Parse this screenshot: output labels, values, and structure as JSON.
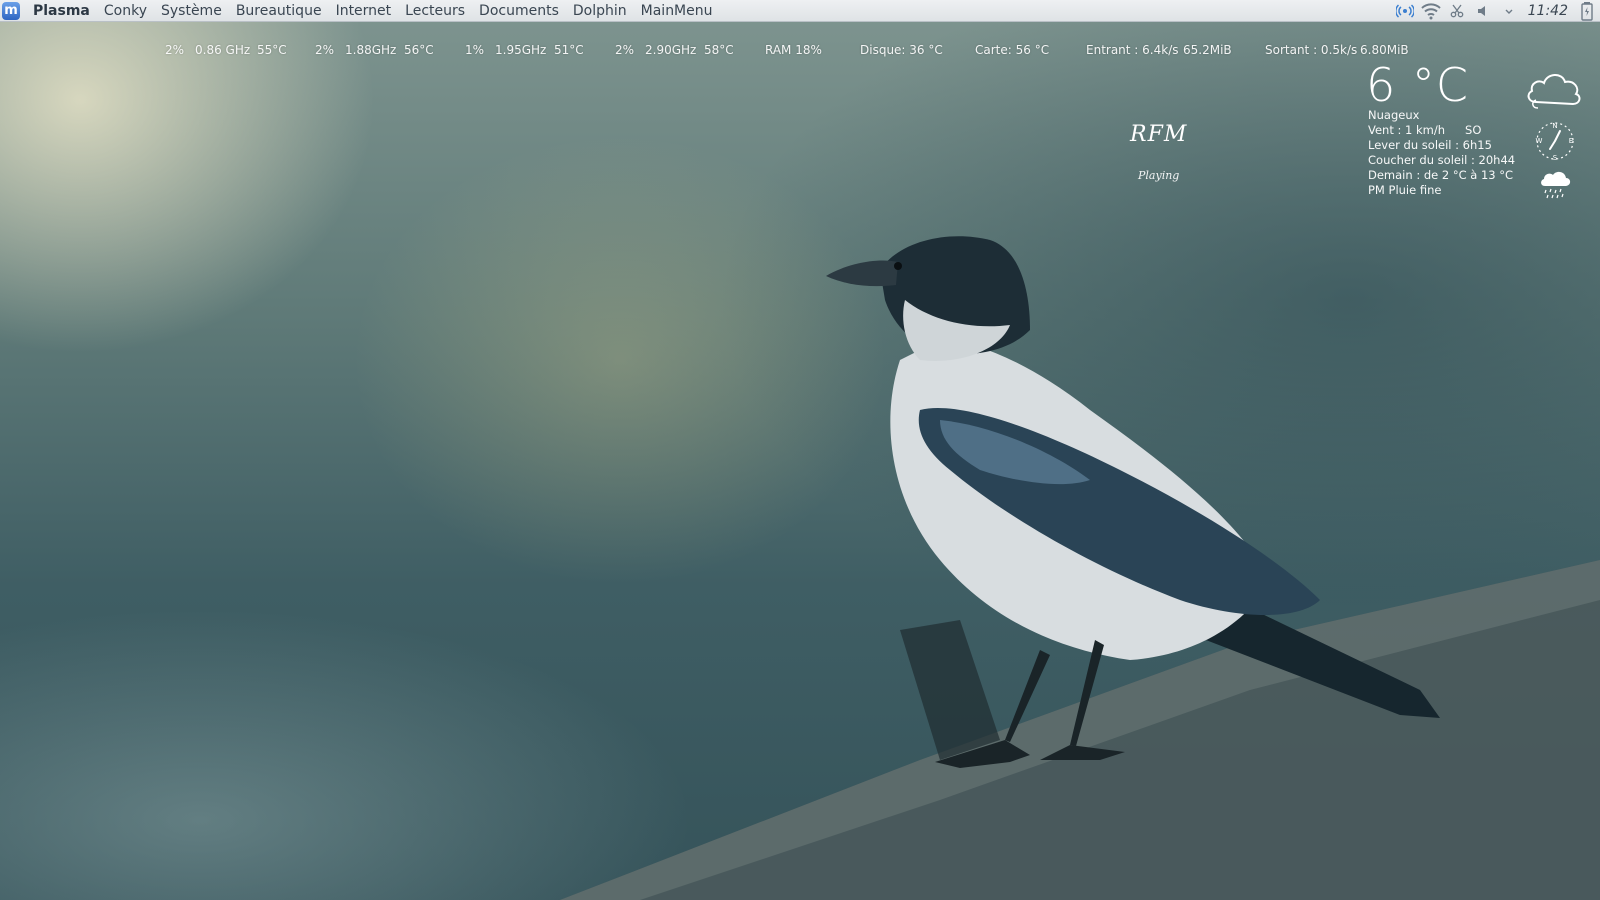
{
  "panel": {
    "launcher_letter": "m",
    "menu_items": [
      "Plasma",
      "Conky",
      "Système",
      "Bureautique",
      "Internet",
      "Lecteurs",
      "Documents",
      "Dolphin",
      "MainMenu"
    ],
    "clock": "11:42",
    "tray_icons": [
      "network-broadcast-icon",
      "wifi-icon",
      "scissors-icon",
      "volume-icon",
      "chevron-down-icon",
      "battery-icon"
    ]
  },
  "conky": {
    "cpu": [
      {
        "usage": "2%",
        "freq": "0.86 GHz",
        "temp": "55°C"
      },
      {
        "usage": "2%",
        "freq": "1.88GHz",
        "temp": "56°C"
      },
      {
        "usage": "1%",
        "freq": "1.95GHz",
        "temp": "51°C"
      },
      {
        "usage": "2%",
        "freq": "2.90GHz",
        "temp": "58°C"
      }
    ],
    "ram": "RAM  18%",
    "disk": "Disque: 36 °C",
    "card": "Carte: 56 °C",
    "net_in": "Entrant : 6.4k/s",
    "net_in_total": "65.2MiB",
    "net_out": "Sortant : 0.5k/s",
    "net_out_total": "6.80MiB"
  },
  "media": {
    "station": "RFM",
    "status": "Playing"
  },
  "weather": {
    "temperature": "6 °C",
    "condition": "Nuageux",
    "wind": "Vent : 1 km/h",
    "wind_direction": "SO",
    "sunrise": "Lever du soleil : 6h15",
    "sunset": "Coucher du soleil : 20h44",
    "tomorrow": "Demain : de 2 °C à 13 °C",
    "tomorrow_pm": "PM Pluie fine",
    "compass_labels": [
      "N",
      "W",
      "E",
      "S"
    ],
    "icons": [
      "cloud-icon",
      "compass-icon",
      "rain-cloud-icon"
    ]
  }
}
